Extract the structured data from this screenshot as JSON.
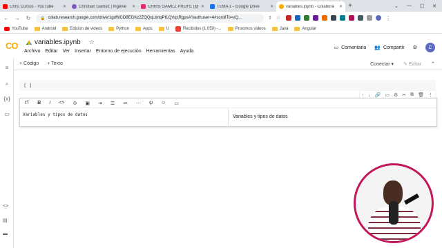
{
  "browser": {
    "tabs": [
      {
        "title": "Chris Cursos - YouTube",
        "color": "#ff0000"
      },
      {
        "title": "Christian Gámez | Ingenie",
        "color": "#7e57c2"
      },
      {
        "title": "CHRIS GÁMEZ PROFE (@",
        "color": "#e1306c"
      },
      {
        "title": "TEMA 1 - Google Drive",
        "color": "#1a73e8"
      },
      {
        "title": "variables.ipynb - Colabora",
        "color": "#f9ab00"
      }
    ],
    "url": "colab.research.google.com/drive/1gdWCD8EGKz2ZQQqLbrtqPfLQVqcRgpsA?authuser=4#scrollTo=vQ...",
    "bookmarks": [
      "YouTube",
      "Android",
      "Edicion de videos",
      "Python",
      "Apps",
      "U",
      "Recibidos (1.050) -...",
      "Proximos videos",
      "Java",
      "Angular"
    ]
  },
  "colab": {
    "logo": "CO",
    "notebook_title": "variables.ipynb",
    "menu": [
      "Archivo",
      "Editar",
      "Ver",
      "Insertar",
      "Entorno de ejecución",
      "Herramientas",
      "Ayuda"
    ],
    "comment_label": "Comentario",
    "share_label": "Compartir",
    "avatar_letter": "C"
  },
  "toolbar": {
    "add_code": "+ Código",
    "add_text": "+ Texto",
    "connect": "Conectar",
    "edit": "Editar"
  },
  "cells": {
    "code_prompt": "[ ]",
    "text_source": "Variables y tipos de datos",
    "text_preview": "Variables y tipos de datos"
  }
}
